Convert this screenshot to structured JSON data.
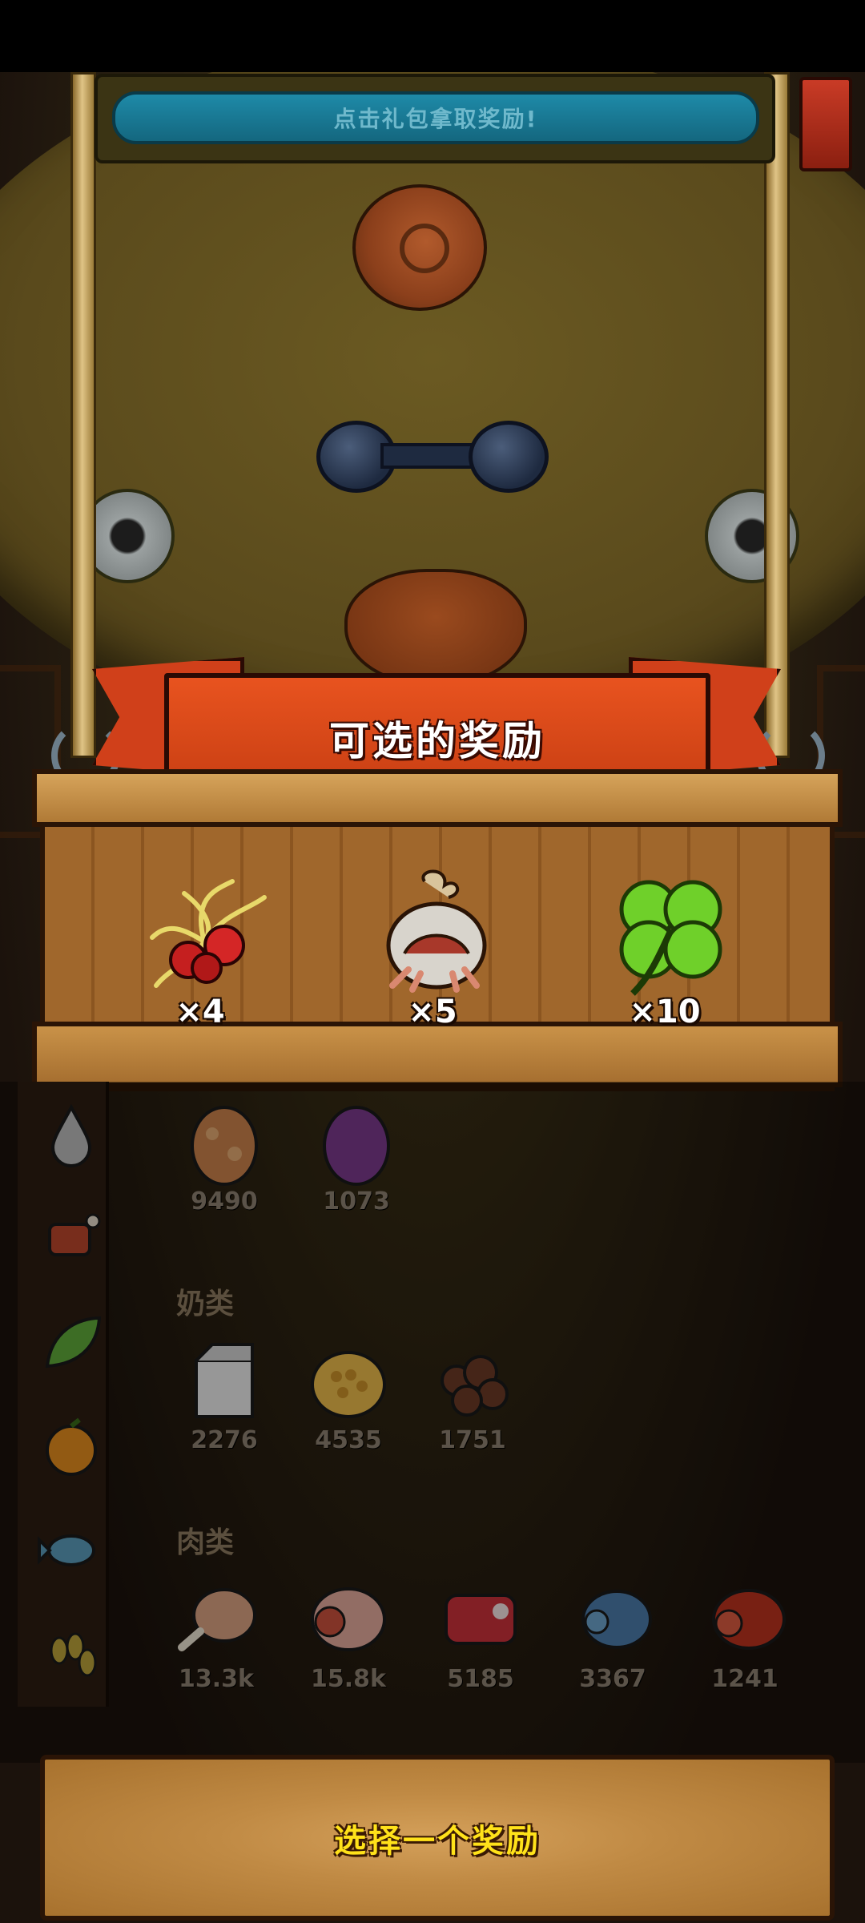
{
  "hint": {
    "text": "点击礼包拿取奖励!"
  },
  "ribbon": {
    "title": "可选的奖励"
  },
  "rewards": [
    {
      "name": "red-berry-vine",
      "qty": "×4"
    },
    {
      "name": "hermit-crab-shell",
      "qty": "×5"
    },
    {
      "name": "four-leaf-clover",
      "qty": "×10"
    }
  ],
  "inventory": {
    "eggs": [
      {
        "icon": "orange-egg-icon",
        "count": "9490"
      },
      {
        "icon": "purple-egg-icon",
        "count": "1073"
      }
    ],
    "dairy": {
      "title": "奶类",
      "items": [
        {
          "icon": "milk-carton-icon",
          "count": "2276"
        },
        {
          "icon": "honeycomb-icon",
          "count": "4535"
        },
        {
          "icon": "chocolate-balls-icon",
          "count": "1751"
        }
      ]
    },
    "meat": {
      "title": "肉类",
      "items": [
        {
          "icon": "drumstick-icon",
          "count": "13.3k"
        },
        {
          "icon": "ham-icon",
          "count": "15.8k"
        },
        {
          "icon": "steak-icon",
          "count": "5185"
        },
        {
          "icon": "blue-meat-icon",
          "count": "3367"
        },
        {
          "icon": "red-meat-roll-icon",
          "count": "1241"
        }
      ]
    }
  },
  "categories": [
    "droplet-icon",
    "meat-icon",
    "leaf-icon",
    "orange-icon",
    "fish-icon",
    "grain-icon"
  ],
  "bottom": {
    "label": "选择一个奖励"
  },
  "colors": {
    "ribbon": "#e8531f",
    "hint_pill": "#1e8aa8",
    "choose_text": "#ffe21a",
    "wood": "#a0672c"
  }
}
